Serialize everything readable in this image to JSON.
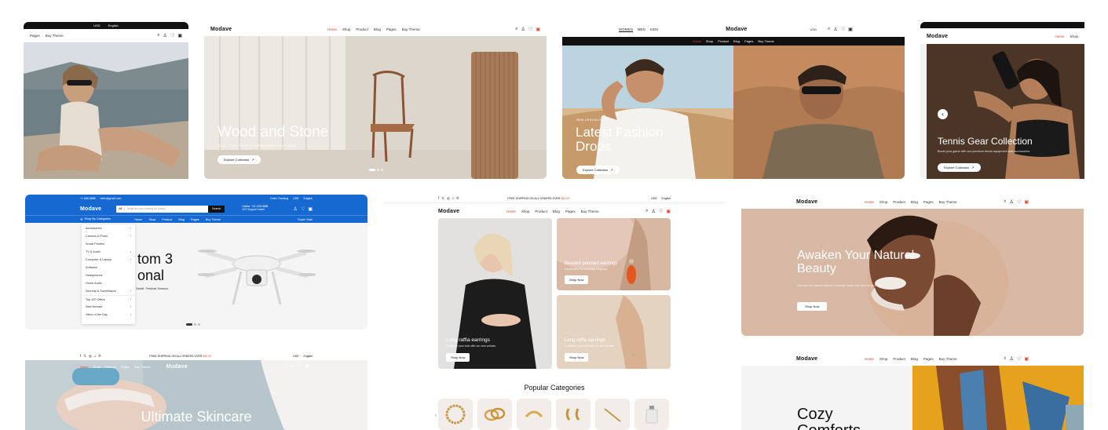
{
  "brand": "Modave",
  "card1": {
    "topbar_currency": "USD",
    "topbar_lang": "English",
    "nav": [
      "Pages",
      "Buy Theme"
    ]
  },
  "card2": {
    "nav": [
      "Home",
      "Shop",
      "Product",
      "Blog",
      "Pages",
      "Buy Theme"
    ],
    "title": "Wood and Stone",
    "subtitle": "Quick: Grab limited-time deals before they're gone",
    "cta": "Explore Collection"
  },
  "card3": {
    "gender_tabs": [
      "WOMEN",
      "MEN",
      "KIDS"
    ],
    "currency": "USD",
    "nav": [
      "Home",
      "Shop",
      "Product",
      "Blog",
      "Pages",
      "Buy Theme"
    ],
    "eyebrow": "NEW ARRIVALS",
    "title": "Latest Fashion Drops",
    "cta": "Explore Collection"
  },
  "card4": {
    "nav": [
      "Home",
      "Shop"
    ],
    "title": "Tennis Gear Collection",
    "subtitle": "Boost your game with our premium tennis equipment and accessories",
    "cta": "Explore Collection"
  },
  "card5": {
    "topbar_phone": "+1 666 8888",
    "topbar_email": "hello@gmail.com",
    "topbar_links": [
      "Order Tracking",
      "USD",
      "English"
    ],
    "search_all": "All",
    "search_placeholder": "What are you looking for today?",
    "search_button": "Search",
    "hotline_label": "Hotline: +01 1234 8888",
    "hotline_sub": "24/7 Support Center",
    "categories_label": "Shop By Categories",
    "nav": [
      "Home",
      "Shop",
      "Product",
      "Blog",
      "Pages",
      "Buy Theme"
    ],
    "seller_label": "Super Sale",
    "menu_items": [
      "Accessories",
      "Camera & Photo",
      "Smart Phones",
      "TV & Audio",
      "Computer & Laptop",
      "Software",
      "Headphones",
      "Home Audio",
      "Security & Surveillance"
    ],
    "menu_extra": [
      "Top 100 Offers",
      "New Arrivals",
      "Value of the Day"
    ],
    "hero_title_1": "tom 3",
    "hero_title_2": "onal",
    "hero_sub": "Detail. Festival Season."
  },
  "card6": {
    "topbar_text": "FREE SHIPPING ON ALL ORDERS OVER",
    "topbar_amount": "$20.00",
    "currency": "USD",
    "lang": "English",
    "nav": [
      "Home",
      "Shop",
      "Product",
      "Blog",
      "Pages",
      "Buy Theme"
    ],
    "tile1_title": "Long raffia earrings",
    "tile1_sub": "Complete your look with our new arrivals",
    "tile1_cta": "Shop Now",
    "tile2_title": "Beaded pendant earrings",
    "tile2_sub": "Handcrafted for everyday elegance",
    "tile2_cta": "Shop Now",
    "tile3_title": "Long raffia earrings",
    "tile3_sub": "Complete your look with our new arrivals",
    "tile3_cta": "Shop Now",
    "section_title": "Popular Categories"
  },
  "card7": {
    "nav": [
      "Home",
      "Shop",
      "Product",
      "Blog",
      "Pages",
      "Buy Theme"
    ],
    "title": "Awaken Your Natural Beauty",
    "subtitle": "Discover our natural skincare products, made with care for your skin",
    "cta": "Shop Now"
  },
  "card8": {
    "topbar_text": "FREE SHIPPING ON ALL ORDERS OVER",
    "topbar_amount": "$20.00",
    "currency": "USD",
    "lang": "English",
    "nav": [
      "Home",
      "Shop",
      "Product",
      "Pages",
      "Buy Theme"
    ],
    "title": "Ultimate Skincare"
  },
  "card9": {
    "nav": [
      "Home",
      "Shop",
      "Product",
      "Blog",
      "Pages",
      "Buy Theme"
    ],
    "title_1": "Cozy",
    "title_2": "Comforts"
  },
  "colors": {
    "accent": "#e2452d",
    "blue": "#1769d2",
    "dark": "#111111"
  }
}
